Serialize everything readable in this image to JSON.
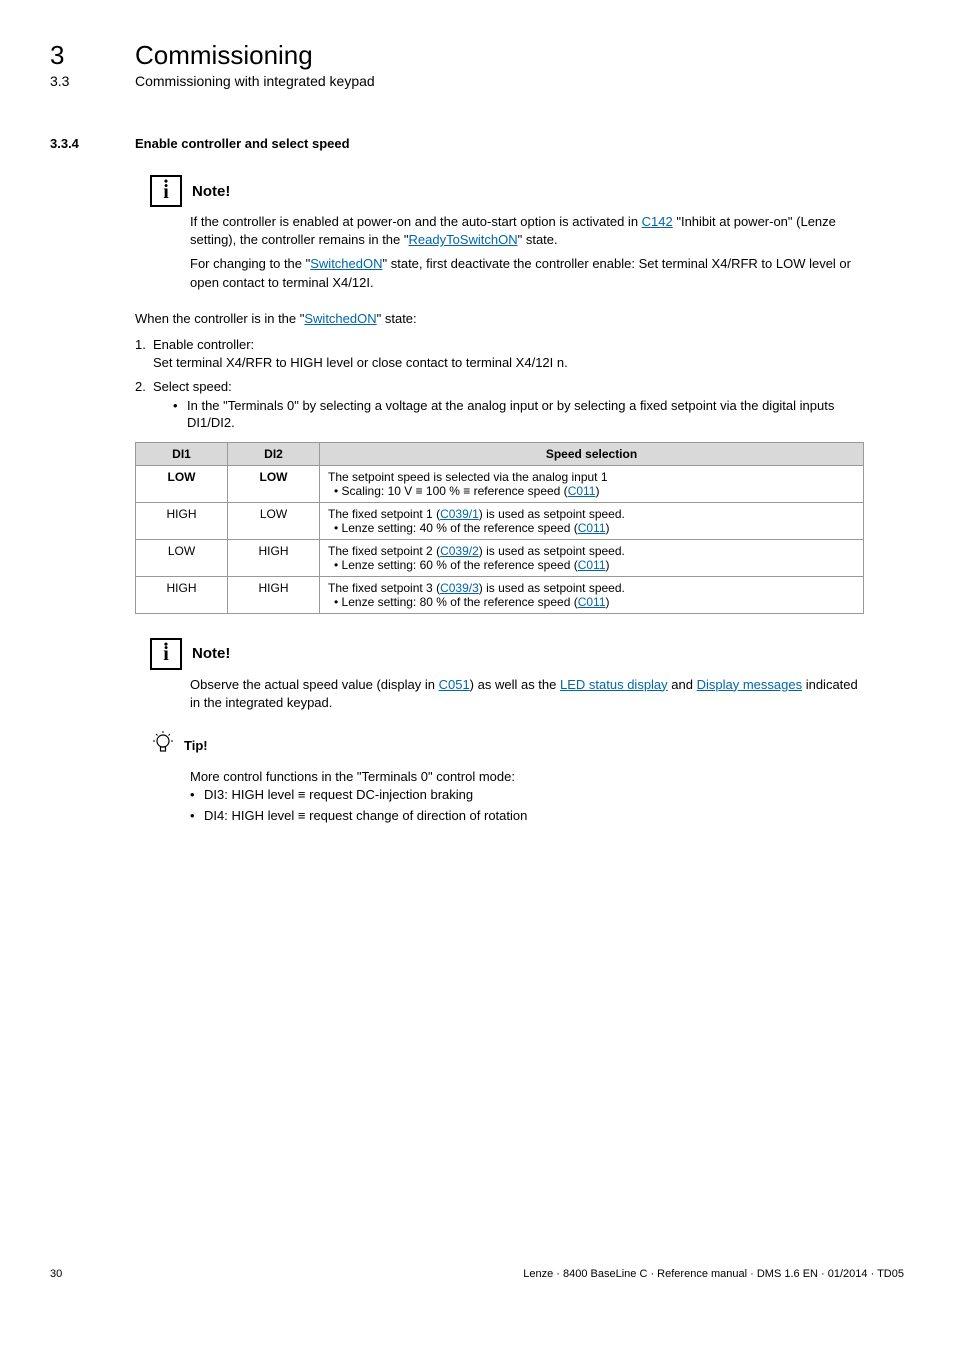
{
  "header": {
    "chapter_num": "3",
    "chapter_title": "Commissioning",
    "section_num": "3.3",
    "section_title": "Commissioning with integrated keypad"
  },
  "dash_rule": "_ _ _ _ _ _ _ _ _ _ _ _ _ _ _ _ _ _ _ _ _ _ _ _ _ _ _ _ _ _ _ _ _ _ _ _ _ _ _ _ _ _ _ _ _ _ _ _ _ _ _ _ _ _ _ _ _ _ _ _ _ _ _ _",
  "subsection": {
    "num": "3.3.4",
    "title": "Enable controller and select speed"
  },
  "note1": {
    "label": "Note!",
    "p1a": "If the controller is enabled at power-on and the auto-start option is activated in ",
    "p1_link1": "C142",
    "p1b": " \"Inhibit at power-on\" (Lenze setting), the controller remains in the \"",
    "p1_link2": "ReadyToSwitchON",
    "p1c": "\" state.",
    "p2a": "For changing to the \"",
    "p2_link": "SwitchedON",
    "p2b": "\" state, first deactivate the controller enable: Set terminal X4/RFR to LOW level or open contact to terminal X4/12I."
  },
  "intro": {
    "a": "When the controller is in the \"",
    "link": "SwitchedON",
    "b": "\" state:"
  },
  "steps": {
    "s1_num": "1.",
    "s1_title": "Enable controller:",
    "s1_body": "Set terminal X4/RFR to HIGH level or close contact to terminal X4/12I n.",
    "s2_num": "2.",
    "s2_title": "Select speed:",
    "s2_bullet": "In the \"Terminals 0\" by selecting a voltage at the analog input or by selecting a fixed setpoint via the digital inputs DI1/DI2."
  },
  "table": {
    "h1": "DI1",
    "h2": "DI2",
    "h3": "Speed selection",
    "rows": [
      {
        "c1": "LOW",
        "c2": "LOW",
        "c1_bold": true,
        "line1": "The setpoint speed is selected via the analog input 1",
        "bullet_a": "Scaling: 10 V ≡ 100 % ≡ reference speed (",
        "bullet_link": "C011",
        "bullet_b": ")"
      },
      {
        "c1": "HIGH",
        "c2": "LOW",
        "line1_a": "The fixed setpoint 1 (",
        "line1_link": "C039/1",
        "line1_b": ") is used as setpoint speed.",
        "bullet_a": "Lenze setting: 40 % of the reference speed (",
        "bullet_link": "C011",
        "bullet_b": ")"
      },
      {
        "c1": "LOW",
        "c2": "HIGH",
        "line1_a": "The fixed setpoint 2 (",
        "line1_link": "C039/2",
        "line1_b": ") is used as setpoint speed.",
        "bullet_a": "Lenze setting: 60 % of the reference speed (",
        "bullet_link": "C011",
        "bullet_b": ")"
      },
      {
        "c1": "HIGH",
        "c2": "HIGH",
        "line1_a": "The fixed setpoint 3 (",
        "line1_link": "C039/3",
        "line1_b": ") is used as setpoint speed.",
        "bullet_a": "Lenze setting: 80 % of the reference speed (",
        "bullet_link": "C011",
        "bullet_b": ")"
      }
    ]
  },
  "note2": {
    "label": "Note!",
    "a": "Observe the actual speed value (display  in ",
    "link1": "C051",
    "b": ") as well as the ",
    "link2": "LED status display",
    "c": " and ",
    "link3": "Display messages",
    "d": " indicated in the integrated keypad."
  },
  "tip": {
    "label": "Tip!",
    "intro": "More control functions in the \"Terminals 0\" control mode:",
    "b1": "DI3: HIGH level ≡ request DC-injection braking",
    "b2": "DI4: HIGH level ≡ request change of direction of rotation"
  },
  "footer": {
    "page": "30",
    "meta": "Lenze · 8400 BaseLine C · Reference manual · DMS 1.6 EN · 01/2014 · TD05"
  }
}
